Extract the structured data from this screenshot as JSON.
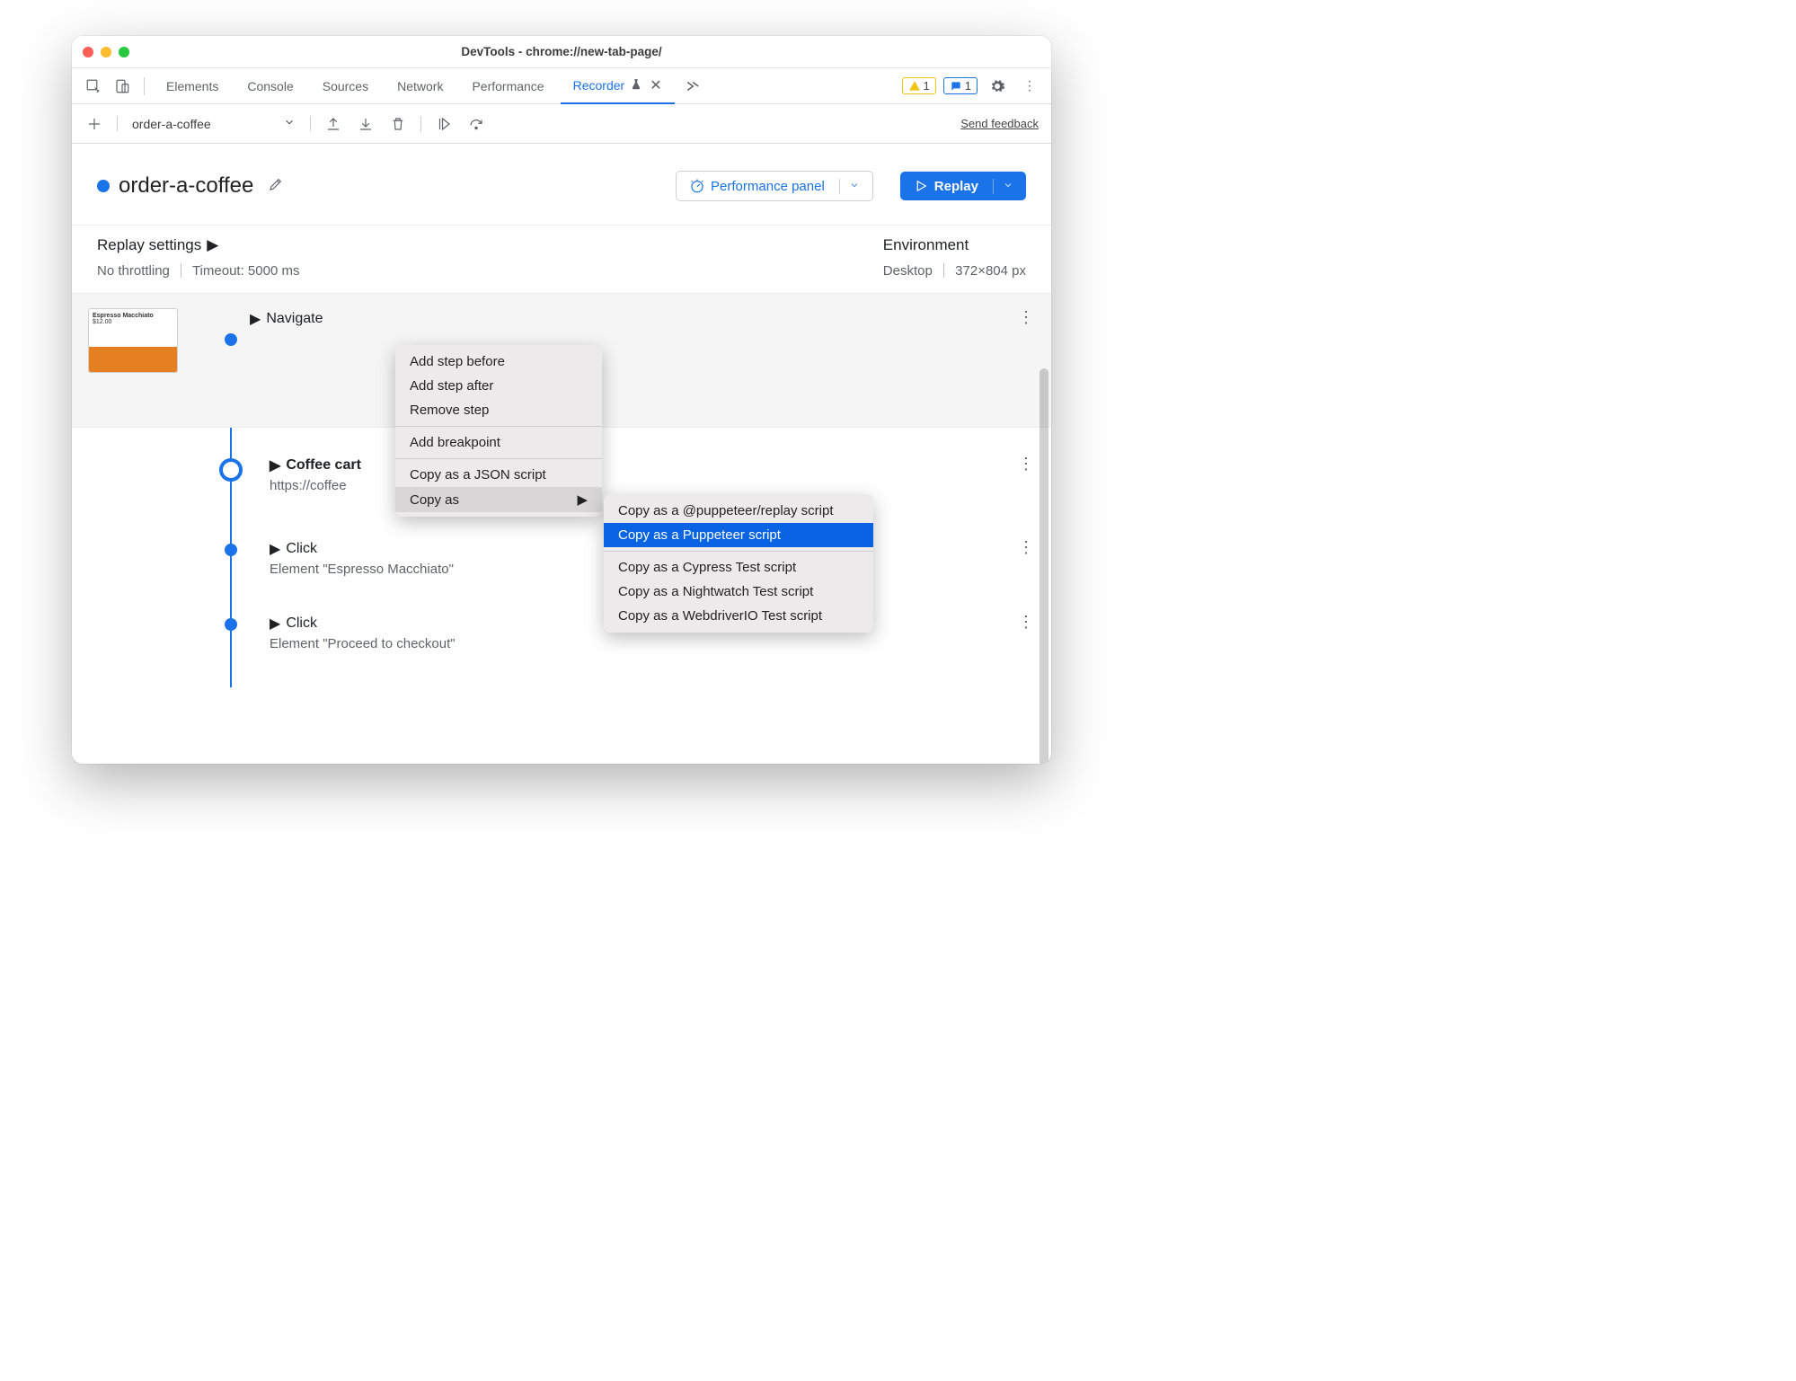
{
  "window": {
    "title": "DevTools - chrome://new-tab-page/"
  },
  "tabs": {
    "elements": "Elements",
    "console": "Console",
    "sources": "Sources",
    "network": "Network",
    "performance": "Performance",
    "recorder": "Recorder",
    "warn_count": "1",
    "info_count": "1"
  },
  "toolbar": {
    "recording_name": "order-a-coffee",
    "feedback": "Send feedback"
  },
  "header": {
    "title": "order-a-coffee",
    "perf_button": "Performance panel",
    "replay_button": "Replay"
  },
  "settings": {
    "replay_hdr": "Replay settings",
    "throttling": "No throttling",
    "timeout": "Timeout: 5000 ms",
    "env_hdr": "Environment",
    "device": "Desktop",
    "viewport": "372×804 px"
  },
  "steps": {
    "navigate": "Navigate",
    "coffee_title": "Coffee cart",
    "coffee_url": "https://coffee",
    "click1_title": "Click",
    "click1_sub": "Element \"Espresso Macchiato\"",
    "click2_title": "Click",
    "click2_sub": "Element \"Proceed to checkout\"",
    "thumb_title": "Espresso Macchiato",
    "thumb_price": "$12.00"
  },
  "menu1": {
    "add_before": "Add step before",
    "add_after": "Add step after",
    "remove": "Remove step",
    "breakpoint": "Add breakpoint",
    "copy_json": "Copy as a JSON script",
    "copy_as": "Copy as"
  },
  "menu2": {
    "replay": "Copy as a @puppeteer/replay script",
    "puppeteer": "Copy as a Puppeteer script",
    "cypress": "Copy as a Cypress Test script",
    "nightwatch": "Copy as a Nightwatch Test script",
    "webdriverio": "Copy as a WebdriverIO Test script"
  }
}
